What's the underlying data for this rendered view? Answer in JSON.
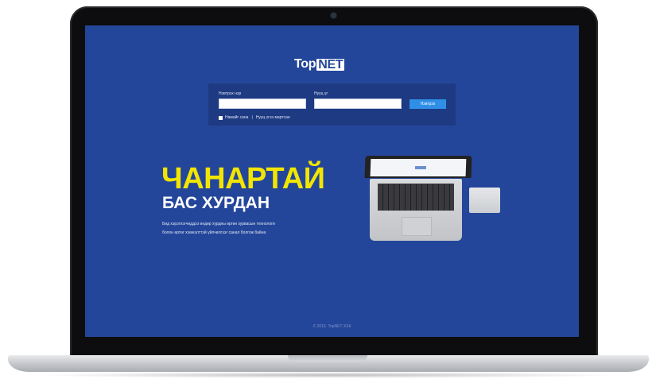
{
  "brand": {
    "logo_prefix": "Top",
    "logo_boxed": "NET"
  },
  "login": {
    "username_label": "Нэвтрэх нэр",
    "password_label": "Нууц үг",
    "username_value": "",
    "password_value": "",
    "submit_label": "Нэвтрэх",
    "remember_label": "Намайг сана",
    "separator": "|",
    "forgot_label": "Нууц үгээ мартсан"
  },
  "hero": {
    "headline_line1": "ЧАНАРТАЙ",
    "headline_line2": "БАС ХУРДАН",
    "desc_line1": "Бид хэрэглэгчиддээ өндөр хурдны өргөн зурвасын технологи",
    "desc_line2": "болон өртөг хэмнэлттэй үйлчилгээг санал болгож байна"
  },
  "footer": {
    "copyright": "© 2016. TopNET ХХК"
  },
  "colors": {
    "screen_bg": "#24469a",
    "headline_yellow": "#f2e500",
    "button_blue": "#2f8fe6"
  }
}
